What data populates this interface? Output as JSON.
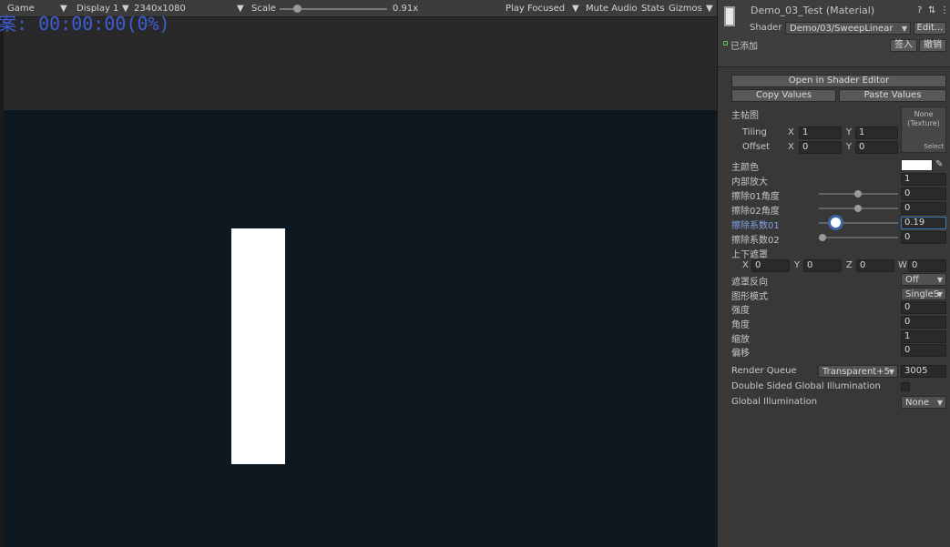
{
  "game_toolbar": {
    "tab": "Game",
    "display": "Display 1",
    "resolution": "2340x1080",
    "scale_label": "Scale",
    "scale_value": "0.91x",
    "play_mode": "Play Focused",
    "mute": "Mute Audio",
    "stats": "Stats",
    "gizmos": "Gizmos"
  },
  "hud": {
    "text": "案: 00:00:00(0%)"
  },
  "inspector": {
    "material_name": "Demo_03_Test (Material)",
    "shader_label": "Shader",
    "shader_value": "Demo/03/SweepLinear",
    "edit_button": "Edit...",
    "added_label": "已添加",
    "checkin_button": "签入",
    "undo_button": "撤销",
    "open_shader_editor": "Open in Shader Editor",
    "copy_values": "Copy Values",
    "paste_values": "Paste Values",
    "main_tex": {
      "label": "主帖图",
      "tiling_label": "Tiling",
      "offset_label": "Offset",
      "tiling_x": "1",
      "tiling_y": "1",
      "offset_x": "0",
      "offset_y": "0",
      "texture_none": "None",
      "texture_type": "(Texture)",
      "select": "Select"
    },
    "props": {
      "main_color": "主颜色",
      "inner_scale": {
        "label": "内部放大",
        "value": "1"
      },
      "erase01_angle": {
        "label": "擦除01角度",
        "value": "0",
        "slider": 0.3
      },
      "erase02_angle": {
        "label": "擦除02角度",
        "value": "0",
        "slider": 0.3
      },
      "erase01_coef": {
        "label": "擦除系数01",
        "value": "0.19",
        "slider": 0.19
      },
      "erase02_coef": {
        "label": "擦除系数02",
        "value": "0",
        "slider": 0
      },
      "mask_label": "上下遮罩",
      "mask_x": "0",
      "mask_y": "0",
      "mask_z": "0",
      "mask_w": "0",
      "mask_invert": {
        "label": "遮罩反向",
        "value": "Off"
      },
      "shape_mode": {
        "label": "图形模式",
        "value": "SingleS"
      },
      "strength": {
        "label": "强度",
        "value": "0"
      },
      "angle": {
        "label": "角度",
        "value": "0"
      },
      "zoom": {
        "label": "缩放",
        "value": "1"
      },
      "offset": {
        "label": "偏移",
        "value": "0"
      }
    },
    "render_queue": {
      "label": "Render Queue",
      "mode": "Transparent+5",
      "value": "3005"
    },
    "double_sided_gi": "Double Sided Global Illumination",
    "global_illumination": {
      "label": "Global Illumination",
      "value": "None"
    }
  },
  "axis_labels": {
    "x": "X",
    "y": "Y",
    "z": "Z",
    "w": "W"
  },
  "colors": {
    "game_bg": "#0d1821",
    "inspector_bg": "#383838",
    "highlight": "#7ea3e6",
    "hud": "#3c5cd8"
  }
}
